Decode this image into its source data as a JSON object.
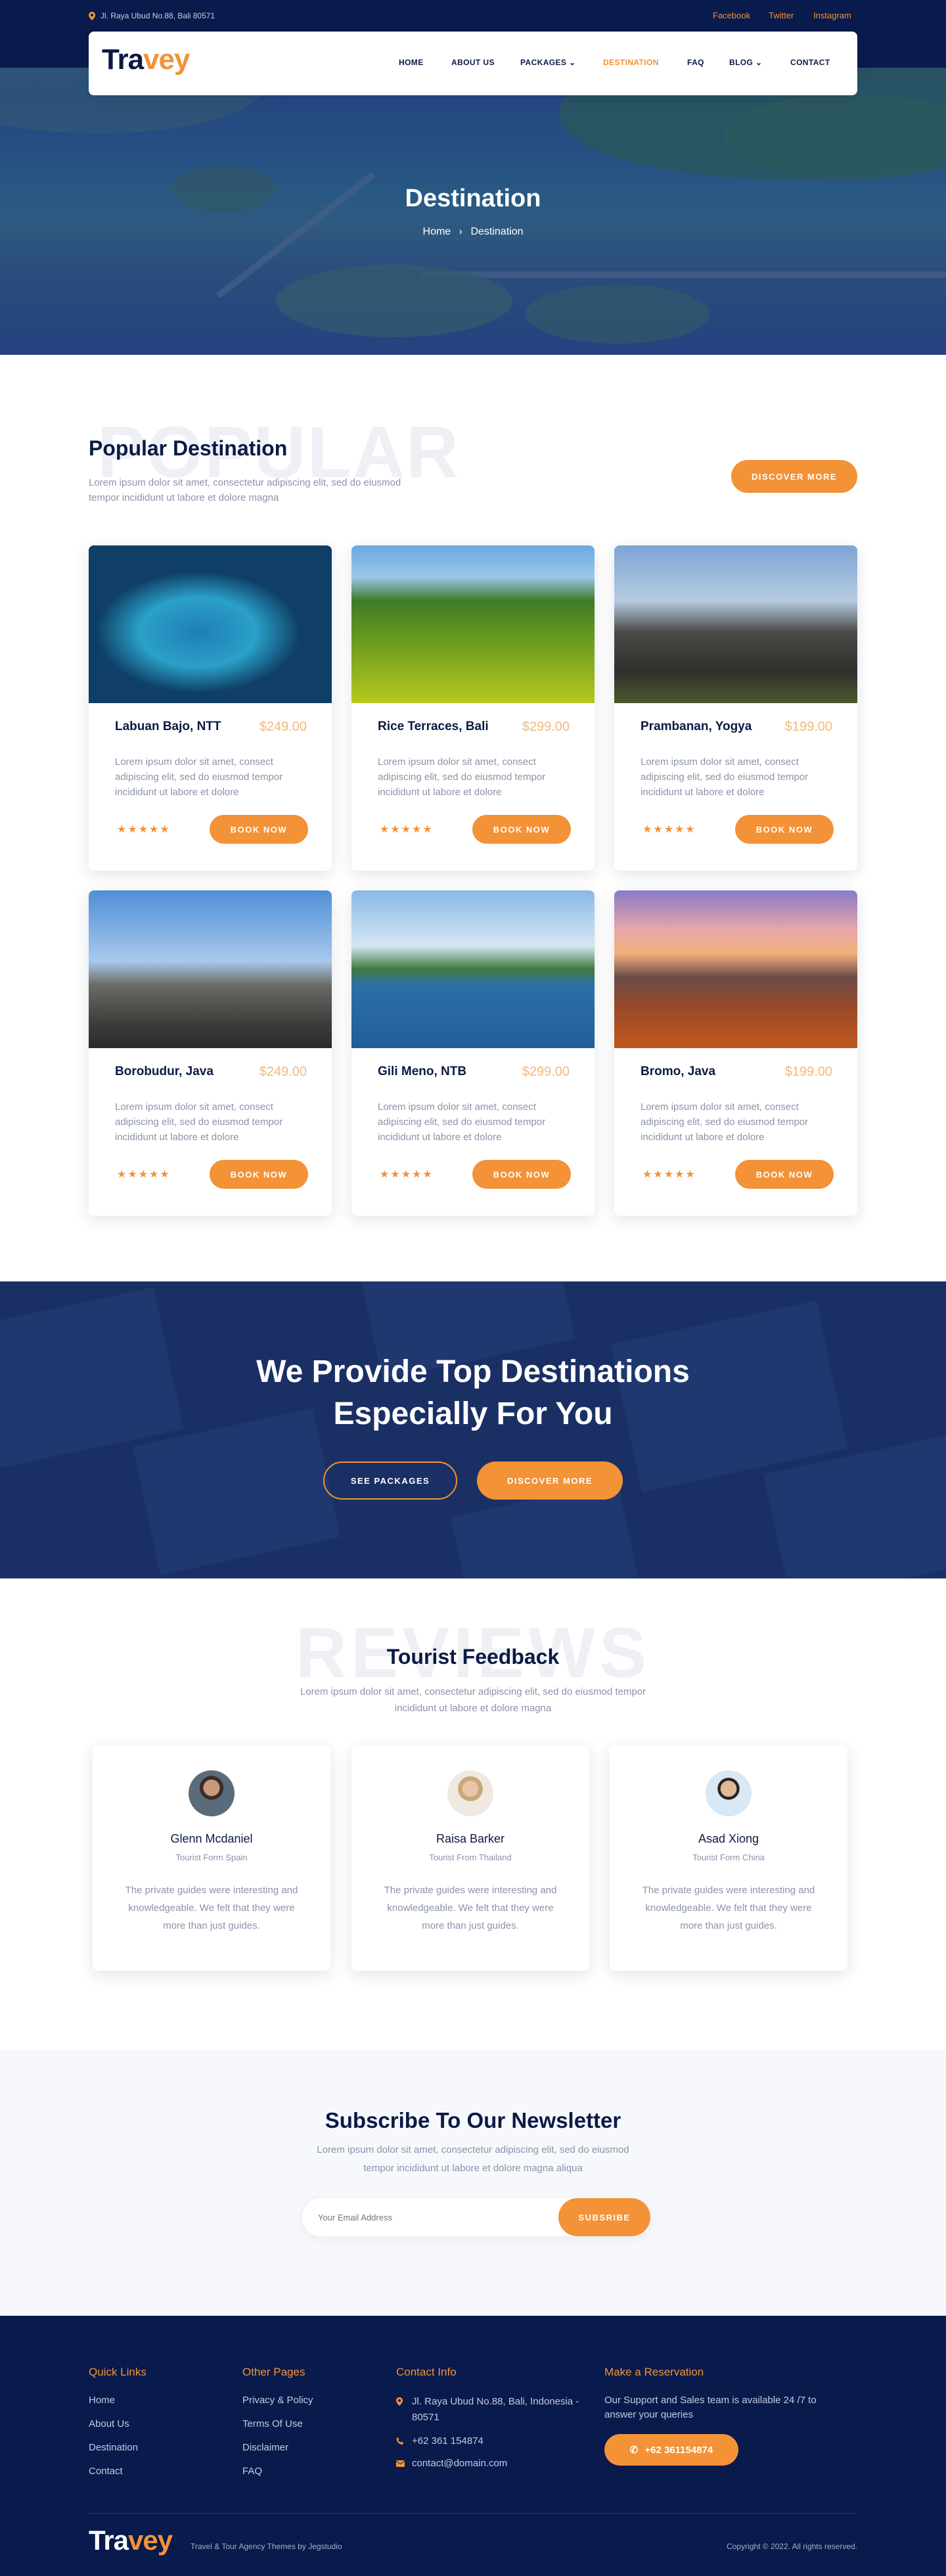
{
  "topbar": {
    "address": "Jl. Raya Ubud No.88, Bali 80571",
    "social": [
      "Facebook",
      "Twitter",
      "Instagram"
    ]
  },
  "brand": {
    "logo_a": "Tra",
    "logo_b": "vey"
  },
  "nav": {
    "home": "HOME",
    "about": "ABOUT US",
    "packages": "PACKAGES",
    "destination": "DESTINATION",
    "faq": "FAQ",
    "blog": "BLOG",
    "contact": "CONTACT"
  },
  "hero": {
    "title": "Destination",
    "crumb_home": "Home",
    "crumb_current": "Destination"
  },
  "popular": {
    "bg_word": "POPULAR",
    "title": "Popular Destination",
    "desc": "Lorem ipsum dolor sit amet, consectetur adipiscing elit, sed do eiusmod tempor incididunt ut labore et dolore magna",
    "button": "DISCOVER MORE",
    "book_label": "BOOK NOW",
    "card_desc": "Lorem ipsum dolor sit amet, consect adipiscing elit, sed do eiusmod tempor incididunt ut labore et dolore",
    "cards": [
      {
        "name": "Labuan Bajo, NTT",
        "price": "$249.00",
        "rating": 5
      },
      {
        "name": "Rice Terraces, Bali",
        "price": "$299.00",
        "rating": 5
      },
      {
        "name": "Prambanan, Yogya",
        "price": "$199.00",
        "rating": 5
      },
      {
        "name": "Borobudur, Java",
        "price": "$249.00",
        "rating": 5
      },
      {
        "name": "Gili Meno, NTB",
        "price": "$299.00",
        "rating": 5
      },
      {
        "name": "Bromo, Java",
        "price": "$199.00",
        "rating": 5
      }
    ]
  },
  "cta": {
    "line1": "We Provide Top Destinations",
    "line2": "Especially For You",
    "btn1": "SEE PACKAGES",
    "btn2": "DISCOVER MORE"
  },
  "reviews": {
    "bg_word": "REVIEWS",
    "title": "Tourist Feedback",
    "desc1": "Lorem ipsum dolor sit amet, consectetur adipiscing elit, sed do eiusmod tempor",
    "desc2": "incididunt ut labore et dolore magna",
    "items": [
      {
        "name": "Glenn Mcdaniel",
        "from": "Tourist Form Spain",
        "text": "The private guides were interesting and knowledgeable. We felt that they were more than just guides."
      },
      {
        "name": "Raisa Barker",
        "from": "Tourist From Thailand",
        "text": "The private guides were interesting and knowledgeable. We felt that they were more than just guides."
      },
      {
        "name": "Asad Xiong",
        "from": "Tourist Form China",
        "text": "The private guides were interesting and knowledgeable. We felt that they were more than just guides."
      }
    ]
  },
  "newsletter": {
    "title": "Subscribe To Our Newsletter",
    "desc1": "Lorem ipsum dolor sit amet, consectetur adipiscing elit, sed do eiusmod",
    "desc2": "tempor incididunt ut labore et dolore magna aliqua",
    "placeholder": "Your Email Address",
    "button": "SUBSRIBE"
  },
  "footer": {
    "quick_title": "Quick Links",
    "quick": [
      "Home",
      "About Us",
      "Destination",
      "Contact"
    ],
    "other_title": "Other Pages",
    "other": [
      "Privacy & Policy",
      "Terms Of Use",
      "Disclaimer",
      "FAQ"
    ],
    "contact_title": "Contact Info",
    "address": "Jl. Raya Ubud No.88, Bali, Indonesia - 80571",
    "phone": "+62 361 154874",
    "email": "contact@domain.com",
    "res_title": "Make a Reservation",
    "res_text": "Our Support and Sales team is available 24 /7 to answer your queries",
    "res_button": "+62 361154874",
    "tagline": "Travel & Tour Agency Themes by Jegstudio",
    "copyright": "Copyright © 2022. All rights reserved."
  },
  "colors": {
    "accent": "#f39237",
    "navy": "#091a4c"
  }
}
